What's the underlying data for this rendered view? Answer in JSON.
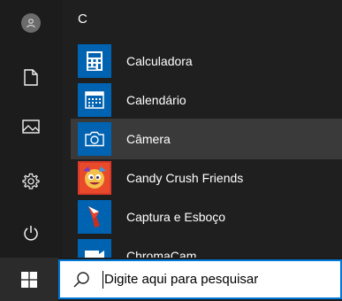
{
  "start_menu": {
    "section_letter": "C",
    "apps": [
      {
        "label": "Calculadora"
      },
      {
        "label": "Calendário"
      },
      {
        "label": "Câmera"
      },
      {
        "label": "Candy Crush Friends"
      },
      {
        "label": "Captura e Esboço"
      },
      {
        "label": "ChromaCam"
      }
    ],
    "selected_app": "Câmera"
  },
  "search": {
    "placeholder": "Digite aqui para pesquisar"
  },
  "colors": {
    "menu_bg": "#1f1f1f",
    "rail_bg": "#1c1c1c",
    "tile_blue": "#0063b1",
    "accent": "#0078d7",
    "selected_bg": "#3a3a3a"
  },
  "icons": {
    "avatar": "user-avatar-icon",
    "documents": "document-icon",
    "pictures": "picture-icon",
    "settings": "gear-icon",
    "power": "power-icon",
    "start": "windows-logo-icon",
    "search": "search-icon"
  }
}
